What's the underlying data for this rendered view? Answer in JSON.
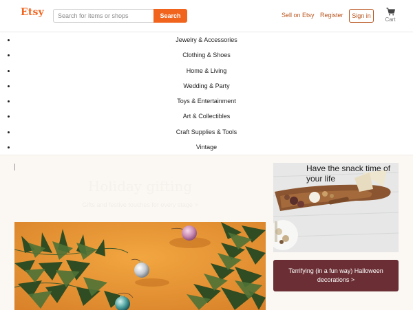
{
  "brand": {
    "logo_text": "Etsy",
    "accent_color": "#f1641e",
    "link_color": "#b9531c"
  },
  "search": {
    "placeholder": "Search for items or shops",
    "value": "",
    "button_label": "Search"
  },
  "header_links": {
    "sell": "Sell on Etsy",
    "register": "Register",
    "signin": "Sign in",
    "cart_label": "Cart",
    "cart_icon": "shopping-cart-icon"
  },
  "categories": [
    "Jewelry & Accessories",
    "Clothing & Shoes",
    "Home & Living",
    "Wedding & Party",
    "Toys & Entertainment",
    "Art & Collectibles",
    "Craft Supplies & Tools",
    "Vintage"
  ],
  "hero": {
    "title": "Holiday gifting",
    "subtitle": "Gifts and festive touches for every stage >"
  },
  "promo": {
    "title": "Have the snack time of your life"
  },
  "halloween": {
    "label": "Terrifying (in a fun way) Halloween decorations >",
    "color": "#6a2e34"
  }
}
